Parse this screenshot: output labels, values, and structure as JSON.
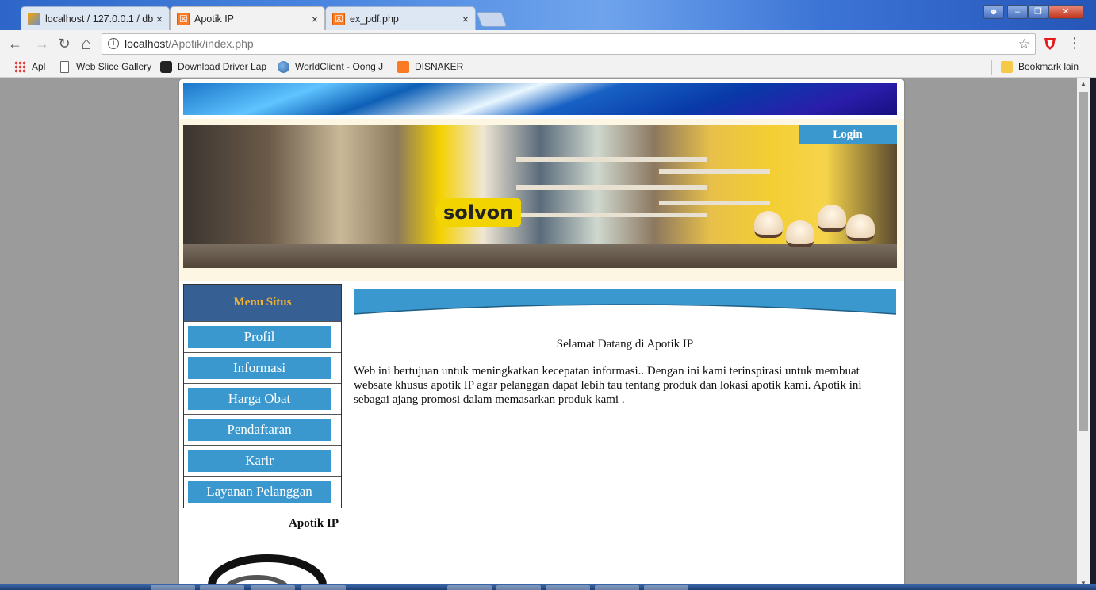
{
  "browser": {
    "tabs": [
      {
        "title": "localhost / 127.0.0.1 / db",
        "icon": "phpmyadmin-icon",
        "active": false
      },
      {
        "title": "Apotik IP",
        "icon": "xampp-icon",
        "active": true
      },
      {
        "title": "ex_pdf.php",
        "icon": "xampp-icon",
        "active": false
      }
    ],
    "close_glyph": "×",
    "url_host": "localhost",
    "url_path": "/Apotik/index.php",
    "info_glyph": "i",
    "star_glyph": "☆",
    "menu_glyph": "⋮",
    "back_glyph": "←",
    "forward_glyph": "→",
    "reload_glyph": "↻",
    "home_glyph": "⌂",
    "bookmarks": [
      {
        "label": "Apl",
        "icon": "apps-icon"
      },
      {
        "label": "Web Slice Gallery",
        "icon": "page-icon"
      },
      {
        "label": "Download Driver Lap",
        "icon": "driver-icon"
      },
      {
        "label": "WorldClient - Oong J",
        "icon": "globe-icon"
      },
      {
        "label": "DISNAKER",
        "icon": "xampp-icon"
      }
    ],
    "other_bookmarks": "Bookmark lain"
  },
  "page": {
    "login": "Login",
    "photo_sign": "solvon",
    "menu_title": "Menu Situs",
    "menu_items": [
      "Profil",
      "Informasi",
      "Harga Obat",
      "Pendaftaran",
      "Karir",
      "Layanan Pelanggan"
    ],
    "sidebar_title": "Apotik IP",
    "welcome": "Selamat Datang di Apotik IP",
    "intro": "Web ini bertujuan untuk meningkatkan kecepatan informasi.. Dengan ini kami terinspirasi untuk membuat websate khusus apotik IP agar pelanggan dapat lebih tau tentang produk dan lokasi apotik kami. Apotik ini sebagai ajang promosi dalam memasarkan produk kami ."
  },
  "colors": {
    "menu_button": "#3a98cf",
    "menu_header_bg": "#365f93",
    "menu_header_text": "#f2b233"
  }
}
